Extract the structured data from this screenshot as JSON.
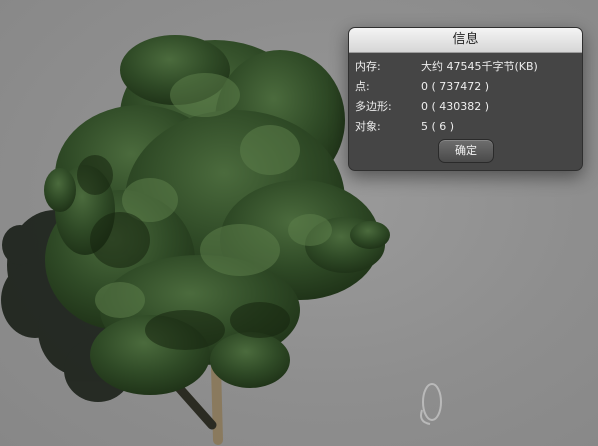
{
  "dialog": {
    "title": "信息",
    "rows": [
      {
        "label": "内存:",
        "value": "大约 47545千字节(KB)"
      },
      {
        "label": "点:",
        "value": "0 ( 737472 )"
      },
      {
        "label": "多边形:",
        "value": "0 ( 430382 )"
      },
      {
        "label": "对象:",
        "value": "5 ( 6 )"
      }
    ],
    "ok_label": "确定"
  },
  "colors": {
    "background": "#8f8f8f",
    "foliage_dark": "#1f3418",
    "foliage_mid": "#2f4a26",
    "foliage_light": "#4b6b3d",
    "trunk": "#8a7a5e",
    "dialog_body": "#424242",
    "dialog_titlebar": "#e2e2e2"
  },
  "icons": {
    "viewport_gizmo": "rotate-gizmo-icon"
  }
}
